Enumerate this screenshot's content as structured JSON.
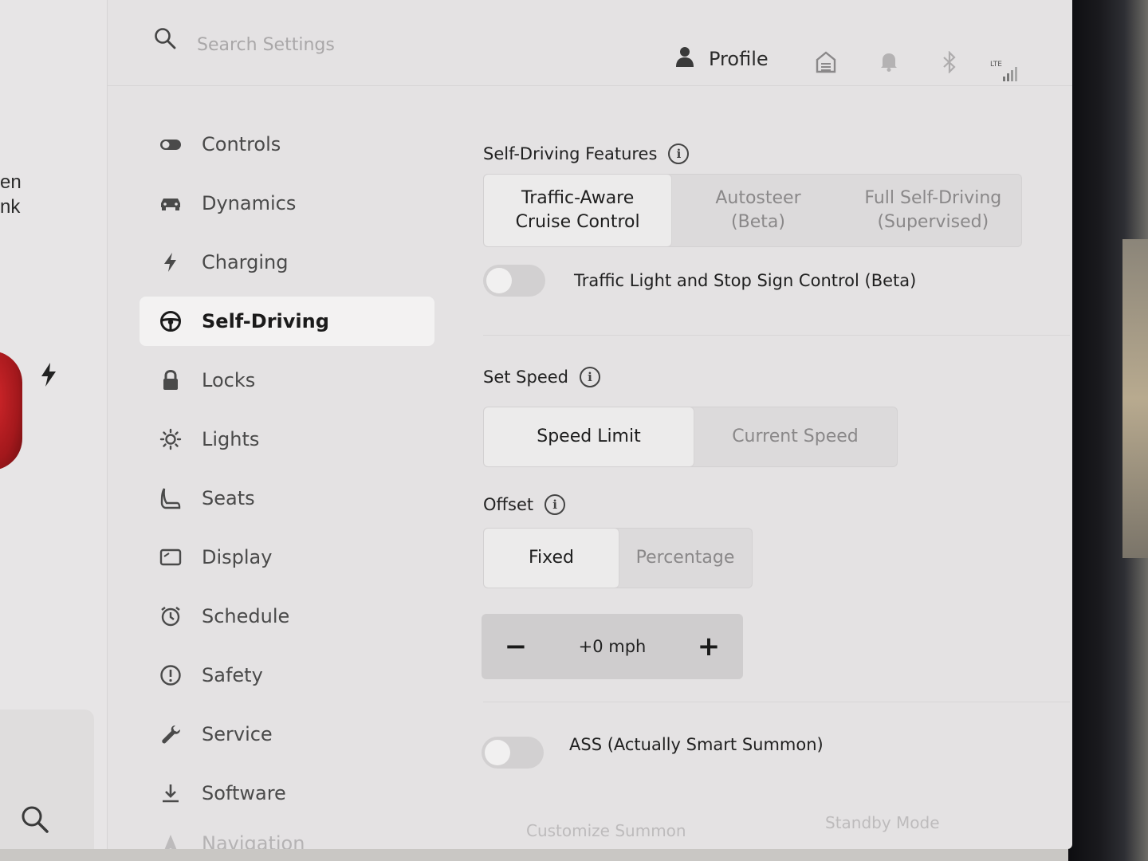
{
  "search": {
    "placeholder": "Search Settings"
  },
  "header": {
    "profile_label": "Profile",
    "lte_label": "LTE"
  },
  "car_panel": {
    "text_line1": "en",
    "text_line2": "nk"
  },
  "sidebar": {
    "items": [
      {
        "label": "Controls"
      },
      {
        "label": "Dynamics"
      },
      {
        "label": "Charging"
      },
      {
        "label": "Self-Driving"
      },
      {
        "label": "Locks"
      },
      {
        "label": "Lights"
      },
      {
        "label": "Seats"
      },
      {
        "label": "Display"
      },
      {
        "label": "Schedule"
      },
      {
        "label": "Safety"
      },
      {
        "label": "Service"
      },
      {
        "label": "Software"
      },
      {
        "label": "Navigation"
      }
    ],
    "active": "Self-Driving"
  },
  "self_driving_features": {
    "title": "Self-Driving Features",
    "options": [
      {
        "line1": "Traffic-Aware",
        "line2": "Cruise Control",
        "selected": true
      },
      {
        "line1": "Autosteer",
        "line2": "(Beta)",
        "selected": false
      },
      {
        "line1": "Full Self-Driving",
        "line2": "(Supervised)",
        "selected": false
      }
    ]
  },
  "traffic_light_toggle": {
    "label": "Traffic Light and Stop Sign Control (Beta)",
    "on": false
  },
  "set_speed": {
    "title": "Set Speed",
    "options": [
      {
        "label": "Speed Limit",
        "selected": true
      },
      {
        "label": "Current Speed",
        "selected": false
      }
    ]
  },
  "offset": {
    "title": "Offset",
    "options": [
      {
        "label": "Fixed",
        "selected": true
      },
      {
        "label": "Percentage",
        "selected": false
      }
    ],
    "stepper": {
      "minus": "−",
      "value": "+0 mph",
      "plus": "+"
    }
  },
  "summon_toggle": {
    "label": "ASS (Actually Smart Summon)",
    "on": false
  },
  "bottom_links": {
    "customize_summon": "Customize Summon",
    "standby_mode": "Standby Mode"
  },
  "colors": {
    "screen_bg": "#e4e2e3",
    "car_red": "#c0202a",
    "selected_seg": "#ecebeb"
  }
}
